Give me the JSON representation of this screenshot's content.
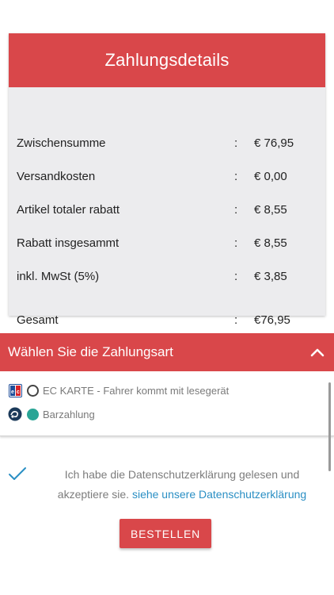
{
  "summary": {
    "title": "Zahlungsdetails",
    "rows": [
      {
        "label": "Zwischensumme",
        "sep": ":",
        "value": "€ 76,95"
      },
      {
        "label": "Versandkosten",
        "sep": ":",
        "value": "€ 0,00"
      },
      {
        "label": "Artikel totaler rabatt",
        "sep": ":",
        "value": "€ 8,55"
      },
      {
        "label": "Rabatt insgesammt",
        "sep": ":",
        "value": "€ 8,55"
      },
      {
        "label": "inkl. MwSt (5%)",
        "sep": ":",
        "value": "€ 3,85"
      },
      {
        "label": "Gesamt",
        "sep": ":",
        "value": "€76,95"
      }
    ]
  },
  "payment": {
    "title": "Wählen Sie die Zahlungsart",
    "options": [
      {
        "label": "EC KARTE - Fahrer kommt mit lesegerät",
        "icon": "ec-card-icon",
        "selected": false
      },
      {
        "label": "Barzahlung",
        "icon": "cash-icon",
        "selected": true
      }
    ]
  },
  "terms": {
    "text": "Ich habe die Datenschutzerklärung gelesen und akzeptiere sie.",
    "link": "siehe unsere Datenschutzerklärung",
    "checked": true
  },
  "order_button": "BESTELLEN",
  "colors": {
    "accent": "#d9474a",
    "selected_radio": "#2aa596",
    "link": "#2a8fc4",
    "check": "#2a8fc4"
  }
}
